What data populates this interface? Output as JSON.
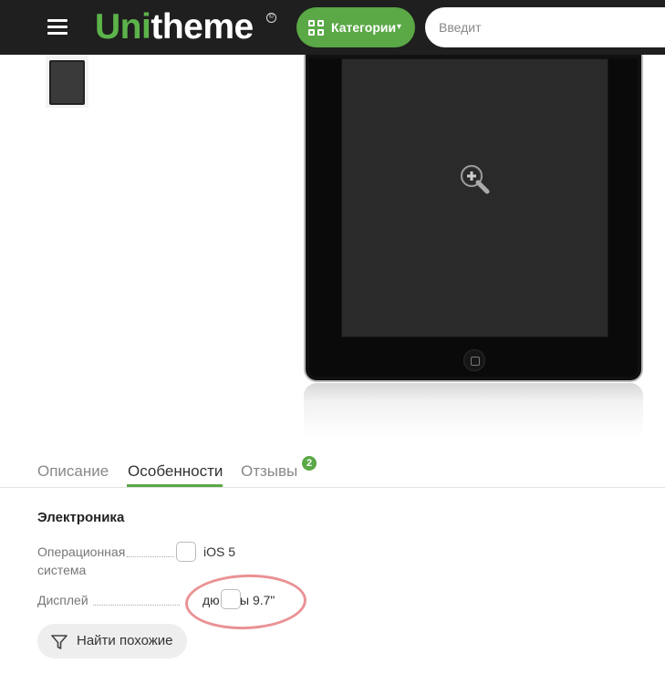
{
  "header": {
    "logo_part1": "Uni",
    "logo_part2": "theme",
    "logo_mark": "©",
    "categories_label": "Категории",
    "search_placeholder": "Введит",
    "icons": [
      "menu-icon",
      "grid-icon",
      "chevron-down-icon"
    ]
  },
  "product": {
    "zoom_icon": "zoom-in-icon",
    "thumbnail_icon": "tablet-thumbnail"
  },
  "tabs": [
    {
      "label": "Описание",
      "active": false
    },
    {
      "label": "Особенности",
      "active": true
    },
    {
      "label": "Отзывы",
      "active": false,
      "badge": "2"
    }
  ],
  "specs": {
    "section_title": "Электроника",
    "rows": [
      {
        "name_line1": "Операционная",
        "name_line2": "система",
        "value": "iOS 5"
      },
      {
        "name_line1": "Дисплей",
        "value": "дю",
        "value_suffix": "ы 9.7\""
      }
    ]
  },
  "find_similar": {
    "label": "Найти похожие",
    "icon": "filter-icon"
  },
  "colors": {
    "brand_green": "#5aa846",
    "header_bg": "#1f1f1f",
    "annotation_circle": "#e8868a"
  }
}
